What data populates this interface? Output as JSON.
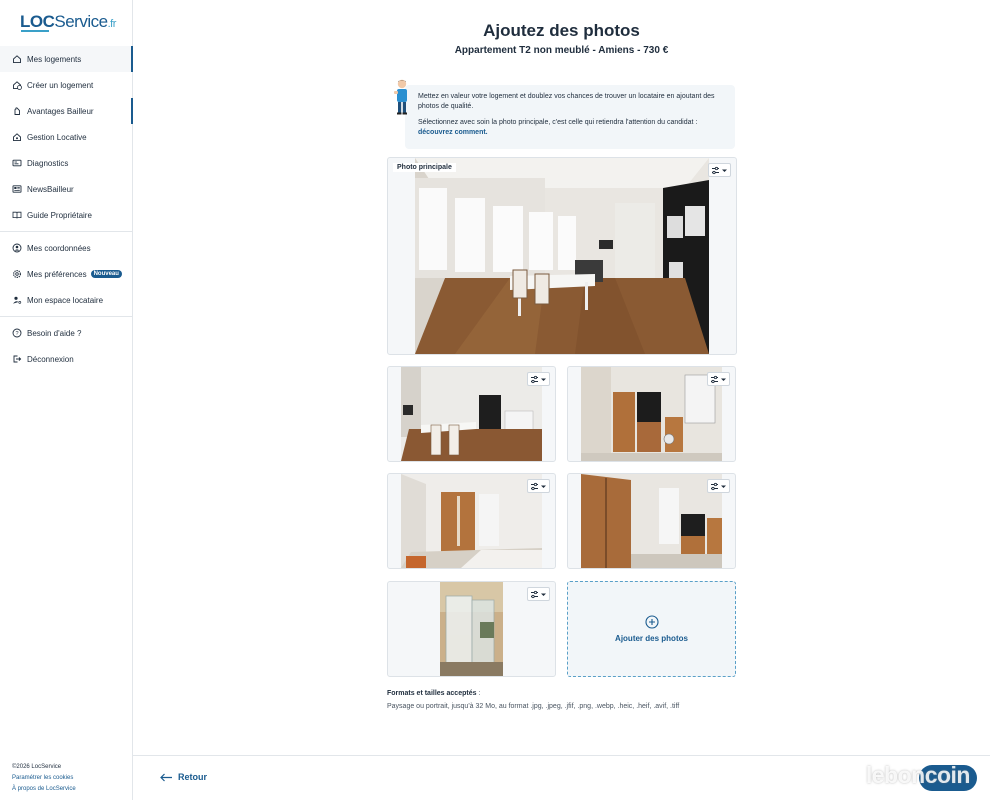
{
  "brand": {
    "name_part1": "LOC",
    "name_part2": "Service",
    "tld": ".fr"
  },
  "sidebar": {
    "items": [
      {
        "label": "Mes logements",
        "icon": "home-icon"
      },
      {
        "label": "Créer un logement",
        "icon": "home-plus-icon"
      },
      {
        "label": "Avantages Bailleur",
        "icon": "hand-icon"
      },
      {
        "label": "Gestion Locative",
        "icon": "home-key-icon"
      },
      {
        "label": "Diagnostics",
        "icon": "id-card-icon"
      },
      {
        "label": "NewsBailleur",
        "icon": "newspaper-icon"
      },
      {
        "label": "Guide Propriétaire",
        "icon": "book-icon"
      },
      {
        "label": "Mes coordonnées",
        "icon": "user-circle-icon"
      },
      {
        "label": "Mes préférences",
        "icon": "gear-icon",
        "badge": "Nouveau"
      },
      {
        "label": "Mon espace locataire",
        "icon": "user-key-icon"
      },
      {
        "label": "Besoin d'aide ?",
        "icon": "help-icon"
      },
      {
        "label": "Déconnexion",
        "icon": "logout-icon"
      }
    ],
    "footer": {
      "copyright": "©2026 LocService",
      "cookies": "Paramétrer les cookies",
      "about": "À propos de LocService"
    }
  },
  "main": {
    "title": "Ajoutez des photos",
    "subtitle": "Appartement T2 non meublé - Amiens - 730 €",
    "advice": {
      "line1": "Mettez en valeur votre logement et doublez vos chances de trouver un locataire en ajoutant des photos de qualité.",
      "line2": "Sélectionnez avec soin la photo principale, c'est celle qui retiendra l'attention du candidat :",
      "link": "découvrez comment."
    },
    "main_photo_tag": "Photo principale",
    "add_photos_label": "Ajouter des photos",
    "formats_title": "Formats et tailles acceptés",
    "formats_sep": " :",
    "formats_text": "Paysage ou portrait, jusqu'à 32 Mo, au format .jpg, .jpeg, .jfif, .png, .webp, .heic, .heif, .avif, .tiff"
  },
  "bottom": {
    "back_label": "Retour",
    "watermark": "leboncoin"
  },
  "colors": {
    "accent": "#1a5b8f",
    "light_bg": "#f2f6f9"
  }
}
